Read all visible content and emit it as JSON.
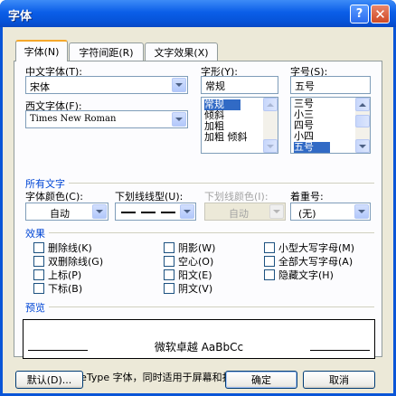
{
  "window": {
    "title": "字体",
    "help_glyph": "?",
    "close_glyph": "✕"
  },
  "tabs": [
    {
      "label": "字体(N)",
      "active": true
    },
    {
      "label": "字符间距(R)",
      "active": false
    },
    {
      "label": "文字效果(X)",
      "active": false
    }
  ],
  "font": {
    "cn_label": "中文字体(T):",
    "cn_value": "宋体",
    "west_label": "西文字体(F):",
    "west_value": "Times New Roman",
    "style_label": "字形(Y):",
    "style_value": "常规",
    "style_list": [
      "常规",
      "倾斜",
      "加粗",
      "加粗 倾斜"
    ],
    "style_selected": "常规",
    "size_label": "字号(S):",
    "size_value": "五号",
    "size_list": [
      "三号",
      "小三",
      "四号",
      "小四",
      "五号"
    ],
    "size_selected": "五号"
  },
  "all_text": {
    "section_label": "所有文字",
    "color_label": "字体颜色(C):",
    "color_value": "自动",
    "underline_label": "下划线线型(U):",
    "underline_color_label": "下划线颜色(I):",
    "underline_color_value": "自动",
    "emphasis_label": "着重号:",
    "emphasis_value": "(无)"
  },
  "effects": {
    "section_label": "效果",
    "items": [
      "删除线(K)",
      "双删除线(G)",
      "上标(P)",
      "下标(B)",
      "阴影(W)",
      "空心(O)",
      "阳文(E)",
      "阴文(V)",
      "小型大写字母(M)",
      "全部大写字母(A)",
      "隐藏文字(H)"
    ]
  },
  "preview": {
    "section_label": "预览",
    "sample_text": "微软卓越 AaBbCc",
    "note": "这是一种 TrueType 字体，同时适用于屏幕和打印机。"
  },
  "buttons": {
    "default_label": "默认(D)...",
    "ok_label": "确定",
    "cancel_label": "取消"
  },
  "colors": {
    "title_bar": "#0b5ee8",
    "dialog_bg": "#ece9d8",
    "section_label": "#0046d5",
    "selection": "#316ac5"
  }
}
